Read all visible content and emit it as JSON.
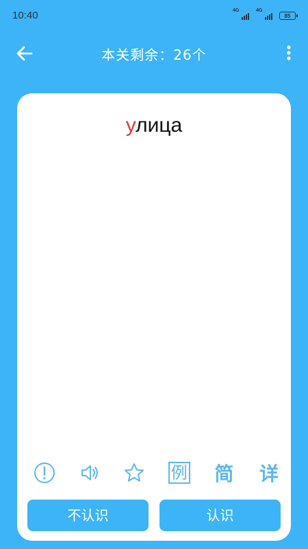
{
  "status_bar": {
    "time": "10:40",
    "signal_1_label": "4G",
    "signal_2_label": "4G",
    "battery_level": "85"
  },
  "header": {
    "title": "本关剩余：26个",
    "back_icon": "arrow-left-icon",
    "more_icon": "more-vertical-icon"
  },
  "card": {
    "word_first": "у",
    "word_rest": "лица"
  },
  "actions": [
    {
      "name": "info",
      "icon": "exclamation-circle-icon"
    },
    {
      "name": "sound",
      "icon": "speaker-icon"
    },
    {
      "name": "favorite",
      "icon": "star-icon"
    },
    {
      "name": "example",
      "label": "例"
    },
    {
      "name": "brief",
      "label": "简"
    },
    {
      "name": "detail",
      "label": "详"
    }
  ],
  "buttons": {
    "unknown": "不认识",
    "known": "认识"
  },
  "colors": {
    "background": "#3cb4f7",
    "accent_letter": "#e03a3a",
    "icon": "#5cb8ec"
  }
}
